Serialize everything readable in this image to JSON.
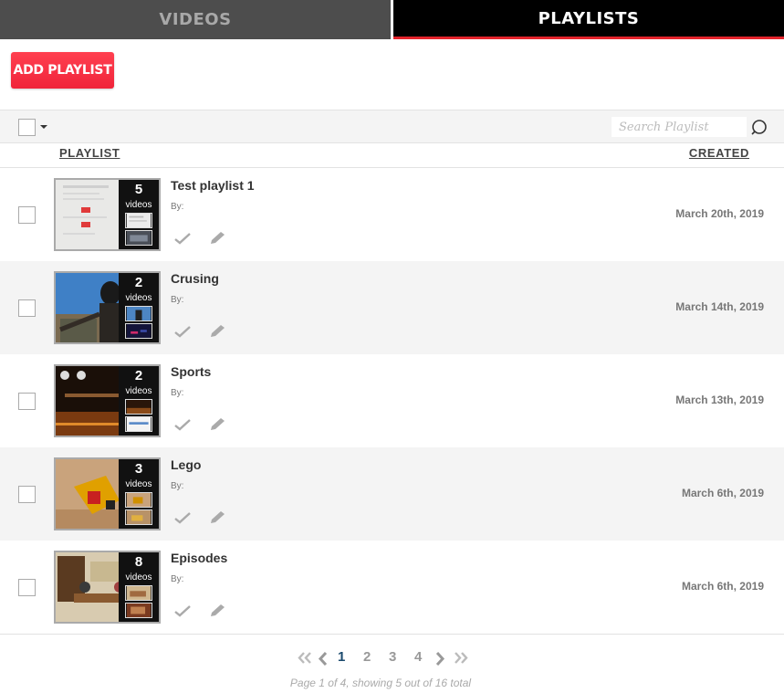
{
  "tabs": {
    "videos_label": "VIDEOS",
    "playlists_label": "PLAYLISTS",
    "active": "playlists"
  },
  "toolbar": {
    "add_label": "ADD PLAYLIST",
    "search_placeholder": "Search Playlist"
  },
  "columns": {
    "playlist": "PLAYLIST",
    "created": "CREATED"
  },
  "playlists": [
    {
      "title": "Test playlist 1",
      "by": "By:",
      "count": "5",
      "count_label": "videos",
      "created": "March 20th, 2019"
    },
    {
      "title": "Crusing",
      "by": "By:",
      "count": "2",
      "count_label": "videos",
      "created": "March 14th, 2019"
    },
    {
      "title": "Sports",
      "by": "By:",
      "count": "2",
      "count_label": "videos",
      "created": "March 13th, 2019"
    },
    {
      "title": "Lego",
      "by": "By:",
      "count": "3",
      "count_label": "videos",
      "created": "March 6th, 2019"
    },
    {
      "title": "Episodes",
      "by": "By:",
      "count": "8",
      "count_label": "videos",
      "created": "March 6th, 2019"
    }
  ],
  "pagination": {
    "pages": [
      "1",
      "2",
      "3",
      "4"
    ],
    "current": "1",
    "status": "Page 1 of 4, showing 5 out of 16 total"
  },
  "colors": {
    "accent": "#e4242c",
    "button": "#f0243a",
    "current_page": "#1b4a6e"
  },
  "icons": {
    "first": "double-chevron-left-icon",
    "prev": "chevron-left-icon",
    "next": "chevron-right-icon",
    "last": "double-chevron-right-icon",
    "search": "search-icon",
    "approve": "checkmark-icon",
    "edit": "pencil-icon"
  }
}
